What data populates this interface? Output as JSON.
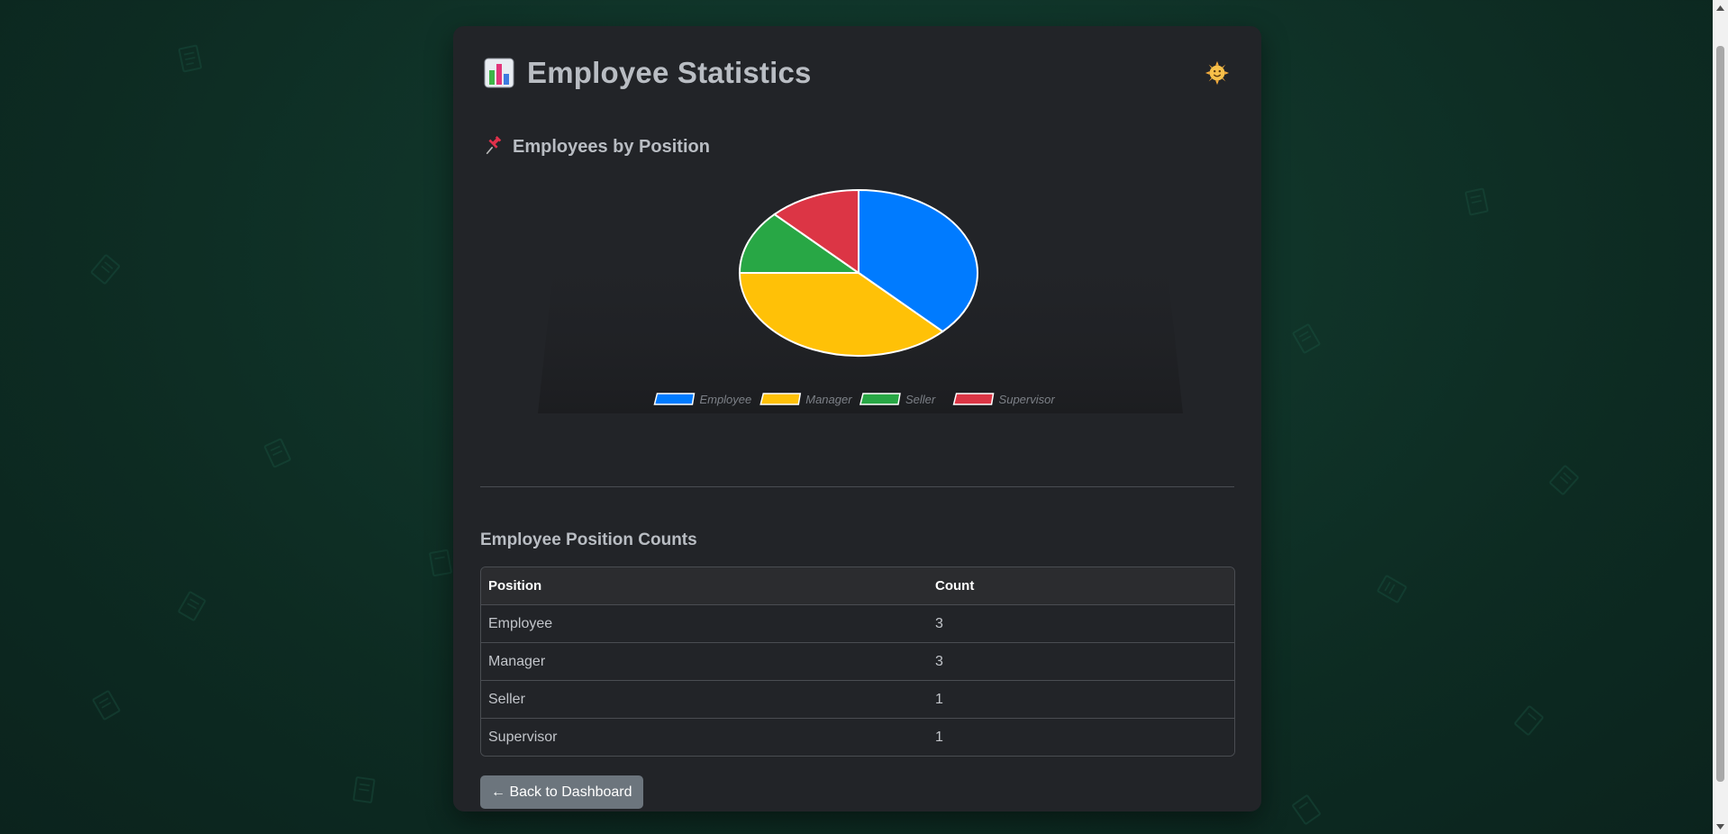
{
  "header": {
    "title": "Employee Statistics",
    "title_icon": "bar-chart-icon",
    "theme_toggle_icon": "sun-face-icon"
  },
  "chart_section": {
    "title": "Employees by Position",
    "icon": "pushpin-icon"
  },
  "chart_data": {
    "type": "pie",
    "categories": [
      "Employee",
      "Manager",
      "Seller",
      "Supervisor"
    ],
    "values": [
      3,
      3,
      1,
      1
    ],
    "colors": [
      "#007bff",
      "#ffc107",
      "#28a745",
      "#dc3545"
    ],
    "legend": "bottom"
  },
  "table": {
    "title": "Employee Position Counts",
    "headers": [
      "Position",
      "Count"
    ],
    "rows": [
      [
        "Employee",
        "3"
      ],
      [
        "Manager",
        "3"
      ],
      [
        "Seller",
        "1"
      ],
      [
        "Supervisor",
        "1"
      ]
    ]
  },
  "actions": {
    "back_label": "← Back to Dashboard"
  },
  "colors": {
    "card_bg": "#222428",
    "page_bg": "#0f3d30",
    "button_bg": "#6c757d"
  }
}
